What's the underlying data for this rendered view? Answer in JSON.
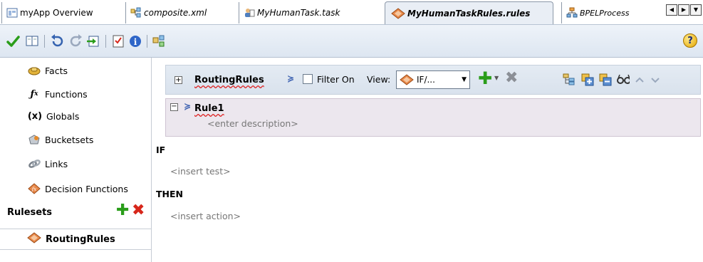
{
  "tabs": [
    {
      "label": "myApp Overview",
      "icon": "overview-icon",
      "active": false
    },
    {
      "label": "composite.xml",
      "icon": "composite-icon",
      "active": false
    },
    {
      "label": "MyHumanTask.task",
      "icon": "human-task-icon",
      "active": false
    },
    {
      "label": "MyHumanTaskRules.rules",
      "icon": "rules-icon",
      "active": true
    },
    {
      "label": "BPELProcess",
      "icon": "bpel-icon",
      "active": false
    }
  ],
  "toolbar": {
    "icons": [
      "validate-icon",
      "book-icon",
      "undo-icon",
      "redo-icon",
      "import-icon",
      "checklist-icon",
      "info-icon",
      "test-icon",
      "help-icon"
    ],
    "help_label": "?"
  },
  "leftnav": {
    "items": [
      {
        "label": "Facts",
        "icon": "facts-icon",
        "glyph": "🚗"
      },
      {
        "label": "Functions",
        "icon": "functions-icon",
        "glyph": "fx"
      },
      {
        "label": "Globals",
        "icon": "globals-icon",
        "glyph": "(x)"
      },
      {
        "label": "Bucketsets",
        "icon": "bucketsets-icon",
        "glyph": "◒"
      },
      {
        "label": "Links",
        "icon": "links-icon",
        "glyph": "⬭"
      },
      {
        "label": "Decision Functions",
        "icon": "decision-functions-icon",
        "glyph": "◆"
      }
    ],
    "rulesets_label": "Rulesets",
    "rulesets": [
      {
        "label": "RoutingRules",
        "icon": "ruleset-icon"
      }
    ]
  },
  "editor": {
    "ruleset_name": "RoutingRules",
    "filter_label": "Filter On",
    "filter_checked": false,
    "view_label": "View:",
    "view_value": "IF/...",
    "rule": {
      "name": "Rule1",
      "description_placeholder": "<enter description>"
    },
    "if_label": "IF",
    "if_placeholder": "<insert test>",
    "then_label": "THEN",
    "then_placeholder": "<insert action>"
  },
  "colors": {
    "accent_green": "#2a9d1a",
    "accent_red": "#d7261a",
    "rule_bg": "#ece7ee",
    "toolbar_bg": "#dde6f1"
  }
}
